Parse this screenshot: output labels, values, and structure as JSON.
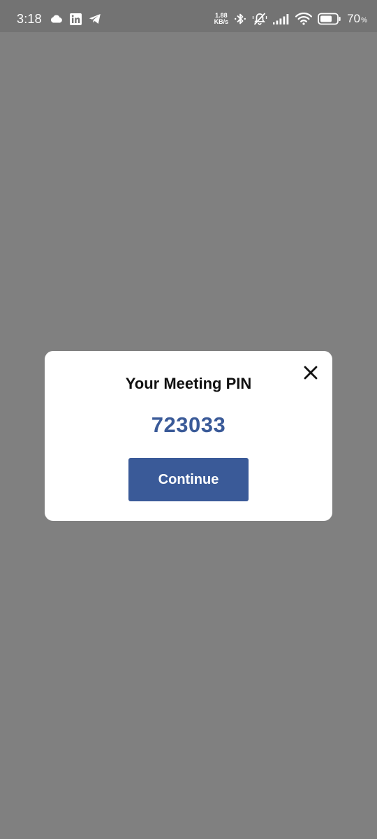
{
  "status_bar": {
    "time": "3:18",
    "net_speed_value": "1.88",
    "net_speed_unit": "KB/s",
    "battery_percent": "70",
    "battery_percent_sign": "%",
    "icons": [
      "cloud-icon",
      "linkedin-icon",
      "telegram-icon",
      "bluetooth-icon",
      "vibrate-off-icon",
      "signal-icon",
      "wifi-icon",
      "battery-icon"
    ]
  },
  "dialog": {
    "title": "Your Meeting PIN",
    "pin": "723033",
    "continue_label": "Continue",
    "close_icon": "close-icon"
  },
  "colors": {
    "backdrop": "#808080",
    "status_bar": "#737373",
    "accent": "#3a5a98",
    "dialog_bg": "#ffffff"
  }
}
